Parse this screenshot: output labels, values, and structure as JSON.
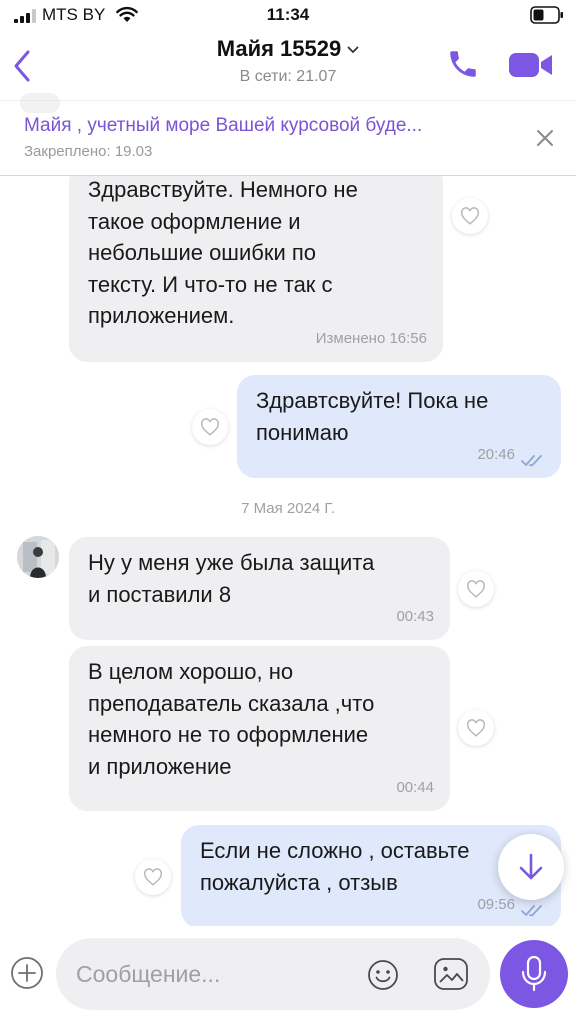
{
  "status_bar": {
    "carrier": "MTS BY",
    "time": "11:34"
  },
  "header": {
    "contact_name": "Майя 15529",
    "status": "В сети: 21.07",
    "icons": [
      "back-icon",
      "chevron-down-icon",
      "phone-icon",
      "video-camera-icon"
    ]
  },
  "pinned": {
    "text": "Майя , учетный море Вашей курсовой буде...",
    "subtitle": "Закреплено: 19.03"
  },
  "messages": [
    {
      "direction": "in",
      "text_lines": [
        "Здравствуйте. Немного не",
        "такое оформление и",
        "небольшие ошибки по",
        "тексту.  И что-то не так с",
        "приложением."
      ],
      "time": "Изменено  16:56"
    },
    {
      "direction": "out",
      "text_lines": [
        "Здравтсвуйте! Пока не",
        "понимаю"
      ],
      "time": "20:46",
      "read": true
    },
    {
      "direction": "in",
      "text_lines": [
        "Ну у меня уже была защита",
        "и поставили 8"
      ],
      "time": "00:43"
    },
    {
      "direction": "in",
      "text_lines": [
        "В целом хорошо, но",
        "преподаватель сказала ,что",
        "немного не то оформление",
        "и приложение"
      ],
      "time": "00:44"
    },
    {
      "direction": "out",
      "text_lines": [
        "Если не сложно , оставьте",
        "пожалуйста , отзыв"
      ],
      "time": "09:56",
      "read": true
    }
  ],
  "date_separator": "7 Мая 2024 Г.",
  "input": {
    "placeholder": "Сообщение...",
    "value": "",
    "icons": [
      "plus-icon",
      "emoji-icon",
      "sticker-icon",
      "microphone-icon"
    ]
  },
  "colors": {
    "accent": "#7b57e3",
    "incoming_bubble": "#efeff1",
    "outgoing_bubble": "#dfe9fb",
    "pinned_text": "#7a54d6",
    "muted_text": "#a0a0a4"
  }
}
